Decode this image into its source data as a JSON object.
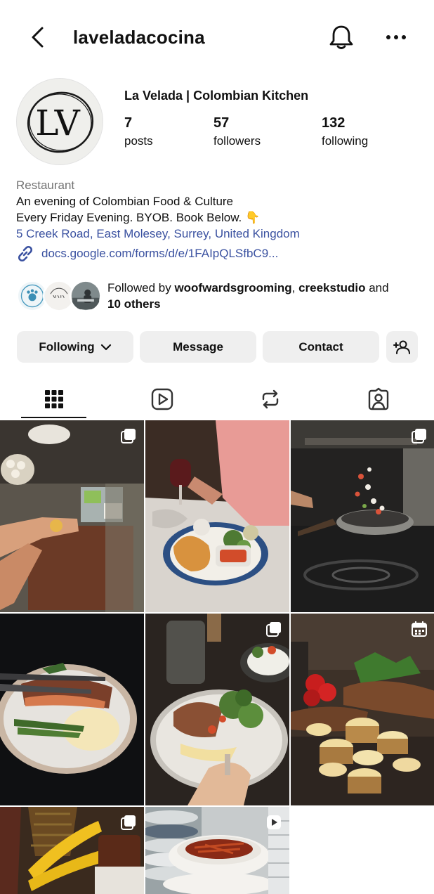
{
  "header": {
    "username": "laveladacocina"
  },
  "profile": {
    "display_name": "La Velada | Colombian Kitchen",
    "avatar_monogram": "LV",
    "stats": [
      {
        "value": "7",
        "label": "posts"
      },
      {
        "value": "57",
        "label": "followers"
      },
      {
        "value": "132",
        "label": "following"
      }
    ]
  },
  "bio": {
    "category": "Restaurant",
    "line1": "An evening of Colombian Food & Culture",
    "line2": "Every Friday Evening. BYOB. Book Below. 👇",
    "location": "5 Creek Road, East Molesey, Surrey, United Kingdom",
    "link": "docs.google.com/forms/d/e/1FAIpQLSfbC9..."
  },
  "followed_by": {
    "prefix": "Followed by ",
    "user1": "woofwardsgrooming",
    "separator": ", ",
    "user2": "creekstudio",
    "suffix": " and",
    "others": "10 others"
  },
  "actions": {
    "following": "Following",
    "message": "Message",
    "contact": "Contact"
  },
  "tabs": [
    {
      "name": "grid-icon",
      "active": true
    },
    {
      "name": "reels-icon",
      "active": false
    },
    {
      "name": "reposts-icon",
      "active": false
    },
    {
      "name": "tagged-icon",
      "active": false
    }
  ],
  "colors": {
    "link": "#3a51a0",
    "button_bg": "#efefef",
    "muted": "#737373"
  }
}
